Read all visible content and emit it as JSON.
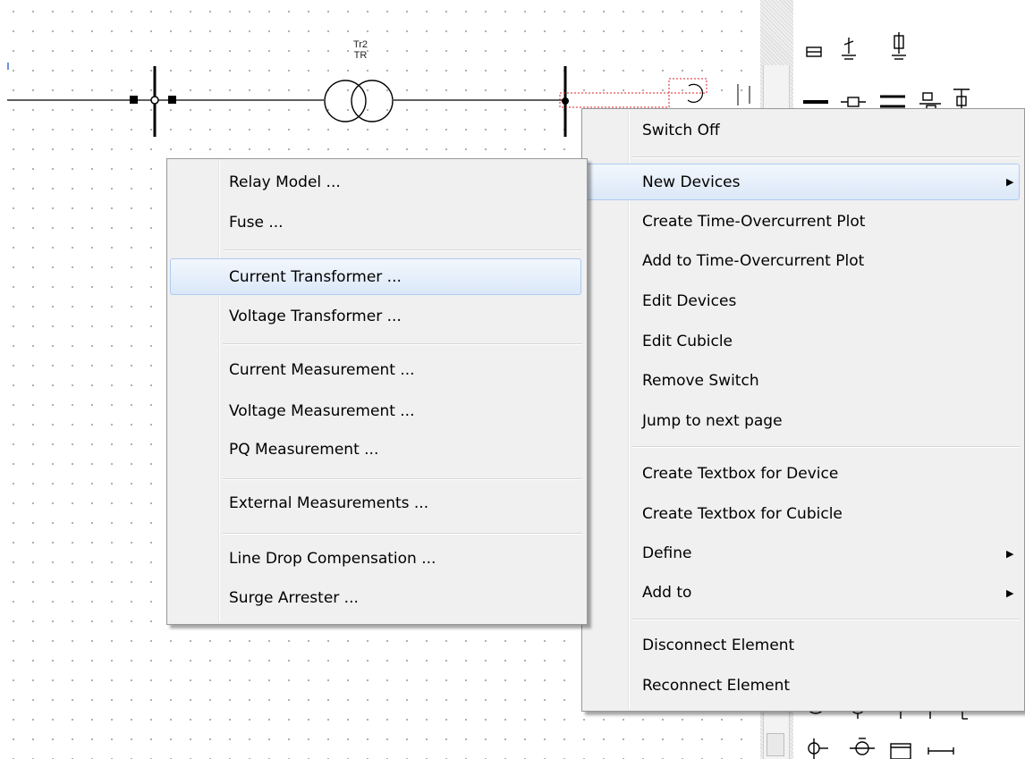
{
  "diagram": {
    "transformer_label_top": "Tr2",
    "transformer_label_bottom": "TR"
  },
  "context_menu": {
    "items": [
      {
        "label": "Switch Off"
      },
      {
        "label": "New Devices",
        "submenu": true,
        "highlighted": true
      },
      {
        "label": "Create Time-Overcurrent Plot"
      },
      {
        "label": "Add to Time-Overcurrent Plot"
      },
      {
        "label": "Edit Devices"
      },
      {
        "label": "Edit Cubicle"
      },
      {
        "label": "Remove Switch"
      },
      {
        "label": "Jump to next page"
      },
      {
        "label": "Create Textbox for Device"
      },
      {
        "label": "Create Textbox for Cubicle"
      },
      {
        "label": "Define",
        "submenu": true
      },
      {
        "label": "Add to",
        "submenu": true
      },
      {
        "label": "Disconnect Element"
      },
      {
        "label": "Reconnect Element"
      }
    ]
  },
  "submenu": {
    "items": [
      {
        "label": "Relay Model ..."
      },
      {
        "label": "Fuse ..."
      },
      {
        "label": "Current Transformer ...",
        "highlighted": true
      },
      {
        "label": "Voltage Transformer ..."
      },
      {
        "label": "Current Measurement ..."
      },
      {
        "label": "Voltage Measurement ..."
      },
      {
        "label": "PQ Measurement ..."
      },
      {
        "label": "External Measurements ..."
      },
      {
        "label": "Line Drop Compensation ..."
      },
      {
        "label": "Surge Arrester ..."
      }
    ]
  },
  "icons": {
    "submenu_arrow": "▶",
    "palette": [
      "fuse-icon",
      "surge-arrester-icon",
      "ground-switch-icon",
      "busbar-icon",
      "breaker-icon",
      "double-busbar-icon",
      "cubicle-icon",
      "terminal-icon",
      "measurement-icon",
      "source-icon",
      "capacitor-icon",
      "ct-icon",
      "motor-icon",
      "box-icon",
      "link-icon"
    ]
  },
  "colors": {
    "menu_bg": "#f0f0f0",
    "highlight_border": "#aecbef",
    "selection_red": "#e0202a"
  }
}
